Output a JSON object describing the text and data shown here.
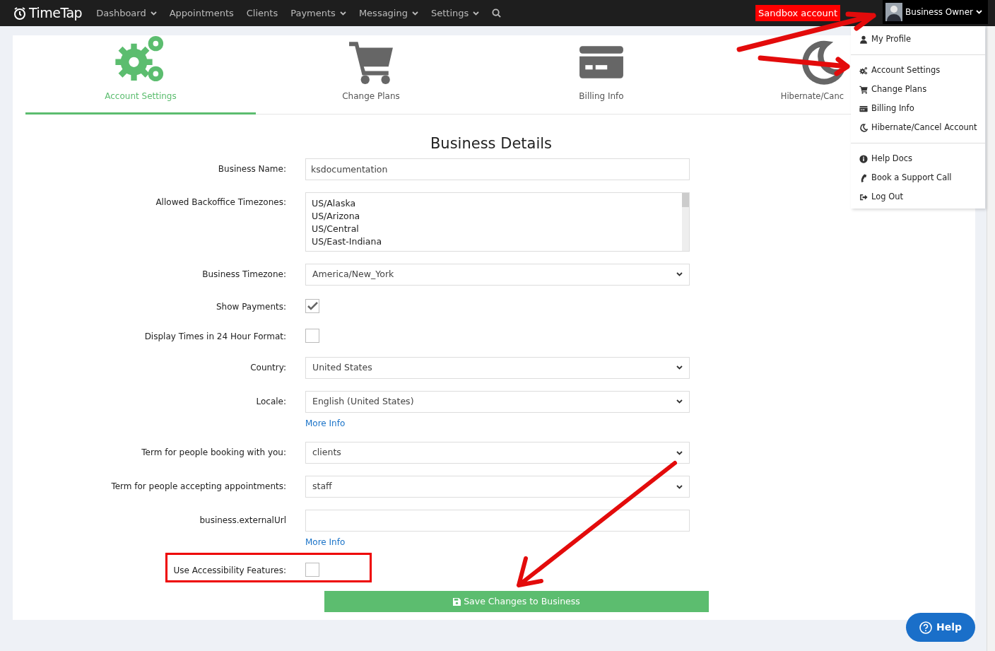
{
  "navbar": {
    "brand": "TimeTap",
    "menu": [
      {
        "label": "Dashboard",
        "dropdown": true
      },
      {
        "label": "Appointments",
        "dropdown": false
      },
      {
        "label": "Clients",
        "dropdown": false
      },
      {
        "label": "Payments",
        "dropdown": true
      },
      {
        "label": "Messaging",
        "dropdown": true
      },
      {
        "label": "Settings",
        "dropdown": true
      }
    ],
    "sandbox_badge": "Sandbox account",
    "user": "Business Owner"
  },
  "tabs": [
    {
      "label": "Account Settings",
      "selected": true
    },
    {
      "label": "Change Plans",
      "selected": false
    },
    {
      "label": "Billing Info",
      "selected": false
    },
    {
      "label": "Hibernate/Canc",
      "selected": false
    }
  ],
  "user_menu": {
    "expanded": true,
    "groups": [
      [
        {
          "label": "My Profile"
        }
      ],
      [
        {
          "label": "Account Settings"
        },
        {
          "label": "Change Plans"
        },
        {
          "label": "Billing Info"
        },
        {
          "label": "Hibernate/Cancel Account"
        }
      ],
      [
        {
          "label": "Help Docs"
        },
        {
          "label": "Book a Support Call"
        },
        {
          "label": "Log Out"
        }
      ]
    ]
  },
  "form": {
    "title": "Business Details",
    "fields": [
      {
        "kind": "text",
        "label": "Business Name:",
        "value": "ksdocumentation"
      },
      {
        "kind": "listbox",
        "label": "Allowed Backoffice Timezones:",
        "options": [
          "US/Alaska",
          "US/Arizona",
          "US/Central",
          "US/East-Indiana"
        ]
      },
      {
        "kind": "select",
        "label": "Business Timezone:",
        "value": "America/New_York"
      },
      {
        "kind": "checkbox",
        "label": "Show Payments:",
        "checked": true
      },
      {
        "kind": "checkbox",
        "label": "Display Times in 24 Hour Format:",
        "checked": false
      },
      {
        "kind": "select",
        "label": "Country:",
        "value": "United States"
      },
      {
        "kind": "select",
        "label": "Locale:",
        "value": "English (United States)",
        "link": "More Info"
      },
      {
        "kind": "select",
        "label": "Term for people booking with you:",
        "value": "clients"
      },
      {
        "kind": "select",
        "label": "Term for people accepting appointments:",
        "value": "staff"
      },
      {
        "kind": "text",
        "label": "business.externalUrl",
        "link": "More Info"
      },
      {
        "kind": "checkbox",
        "label": "Use Accessibility Features:",
        "checked": false,
        "highlighted": true
      }
    ],
    "save_button": "Save Changes to Business"
  },
  "help_button": "Help"
}
